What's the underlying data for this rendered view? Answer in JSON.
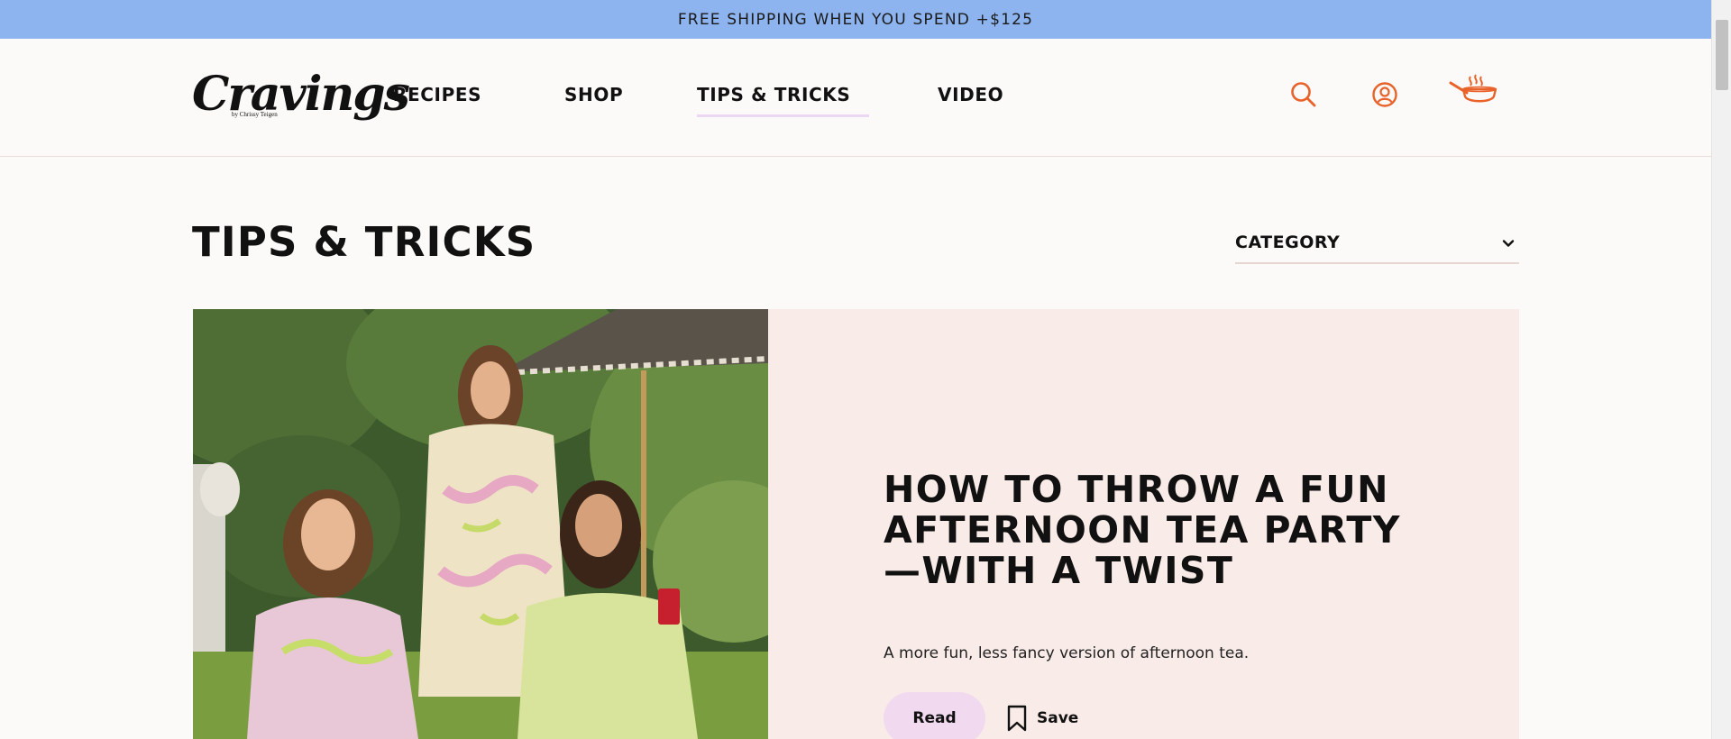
{
  "promo": {
    "text": "FREE SHIPPING WHEN YOU SPEND +$125"
  },
  "brand": {
    "name": "Cravings",
    "byline": "by Chrissy Teigen"
  },
  "nav": {
    "items": [
      {
        "label": "RECIPES"
      },
      {
        "label": "SHOP"
      },
      {
        "label": "TIPS & TRICKS",
        "active": true
      },
      {
        "label": "VIDEO"
      }
    ]
  },
  "header_icons": {
    "search": "search-icon",
    "account": "user-circle-icon",
    "cart": "frying-pan-icon",
    "accent_color": "#e8622a"
  },
  "page": {
    "title": "TIPS & TRICKS"
  },
  "filter": {
    "category_label": "CATEGORY"
  },
  "featured": {
    "title": "HOW TO THROW A FUN AFTERNOON TEA PARTY—WITH A TWIST",
    "subtitle": "A more fun, less fancy version of afternoon tea.",
    "read_label": "Read",
    "save_label": "Save",
    "image_alt": "Three women in silky floral robes having a garden tea party under a striped umbrella"
  },
  "colors": {
    "promo_bg": "#8db4ef",
    "card_bg": "#f9ece8",
    "read_btn": "#f1d9f0",
    "nav_active_underline": "#ead8f2"
  }
}
